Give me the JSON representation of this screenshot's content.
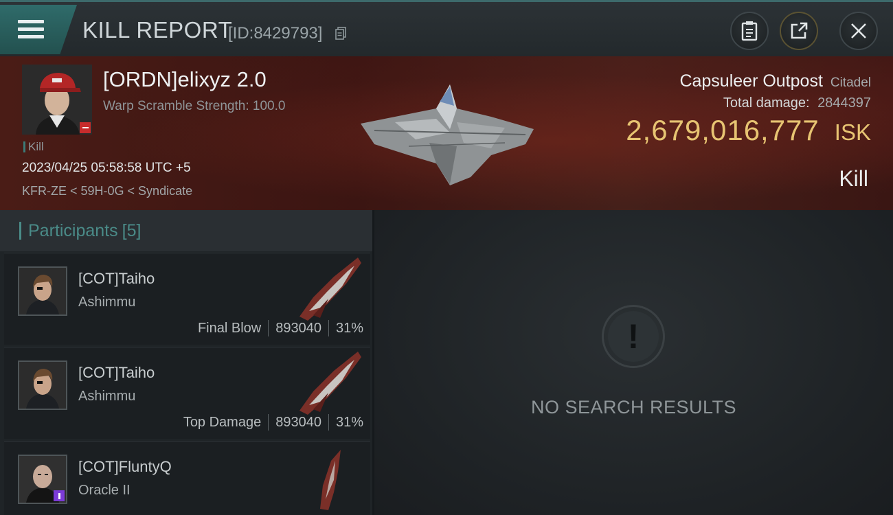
{
  "header": {
    "title": "KILL REPORT",
    "kill_id": "[ID:8429793]",
    "icons": [
      "menu-icon",
      "copy-icon",
      "clipboard-icon",
      "export-icon",
      "close-icon"
    ]
  },
  "victim": {
    "name": "[ORDN]elixyz 2.0",
    "scramble": "Warp Scramble Strength: 100.0",
    "tag": "Kill",
    "datetime": "2023/04/25 05:58:58 UTC +5",
    "location": "KFR-ZE < 59H-0G < Syndicate",
    "ship": "Capsuleer Outpost",
    "ship_class": "Citadel",
    "total_damage_label": "Total damage:",
    "total_damage": "2844397",
    "isk_value": "2,679,016,777",
    "isk_unit": "ISK",
    "result": "Kill"
  },
  "participants": {
    "label": "Participants",
    "count": "[5]",
    "rows": [
      {
        "name": "[COT]Taiho",
        "ship": "Ashimmu",
        "role": "Final Blow",
        "damage": "893040",
        "percent": "31%"
      },
      {
        "name": "[COT]Taiho",
        "ship": "Ashimmu",
        "role": "Top Damage",
        "damage": "893040",
        "percent": "31%"
      },
      {
        "name": "[COT]FluntyQ",
        "ship": "Oracle II",
        "role": "",
        "damage": "",
        "percent": ""
      }
    ]
  },
  "empty_state": {
    "message": "NO SEARCH RESULTS"
  },
  "colors": {
    "accent": "#3d6a6b",
    "isk": "#e7c472",
    "banner": "#4a1c16"
  }
}
